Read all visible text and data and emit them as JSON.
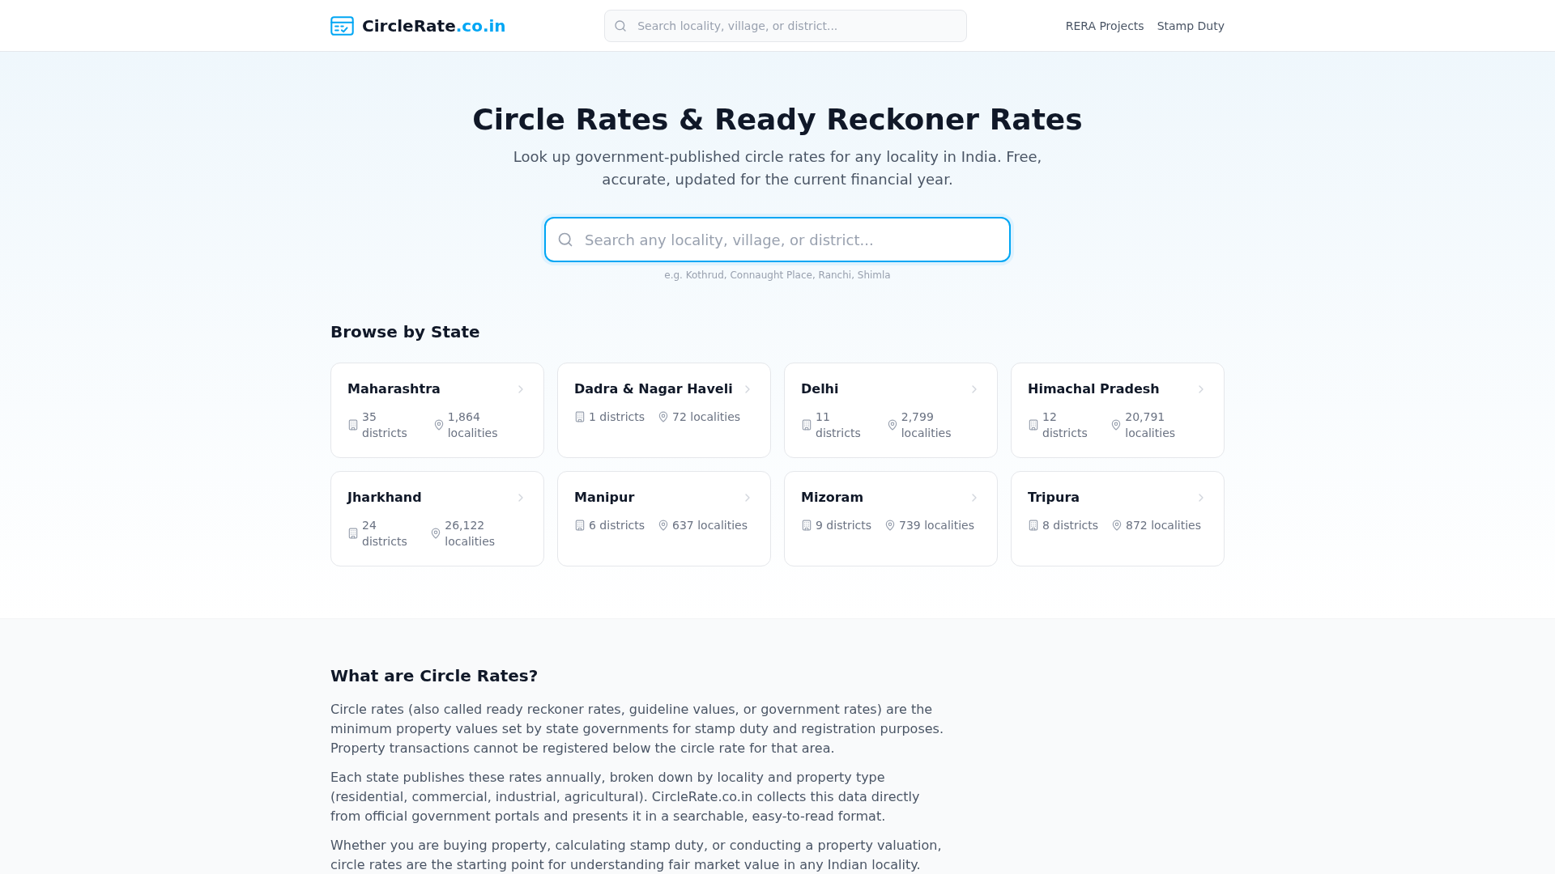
{
  "header": {
    "logo": {
      "name": "CircleRate",
      "suffix": ".co.in"
    },
    "search": {
      "placeholder": "Search locality, village, or district..."
    },
    "nav": [
      "RERA Projects",
      "Stamp Duty"
    ]
  },
  "hero": {
    "title": "Circle Rates & Ready Reckoner Rates",
    "subtitle": "Look up government-published circle rates for any locality in India. Free, accurate, updated for the current financial year.",
    "search": {
      "placeholder": "Search any locality, village, or district...",
      "focused": true
    },
    "hint": "e.g. Kothrud, Connaught Place, Ranchi, Shimla"
  },
  "browse": {
    "heading": "Browse by State",
    "states": [
      {
        "name": "Maharashtra",
        "districts": "35 districts",
        "localities": "1,864 localities"
      },
      {
        "name": "Dadra & Nagar Haveli",
        "districts": "1 districts",
        "localities": "72 localities"
      },
      {
        "name": "Delhi",
        "districts": "11 districts",
        "localities": "2,799 localities"
      },
      {
        "name": "Himachal Pradesh",
        "districts": "12 districts",
        "localities": "20,791 localities"
      },
      {
        "name": "Jharkhand",
        "districts": "24 districts",
        "localities": "26,122 localities"
      },
      {
        "name": "Manipur",
        "districts": "6 districts",
        "localities": "637 localities"
      },
      {
        "name": "Mizoram",
        "districts": "9 districts",
        "localities": "739 localities"
      },
      {
        "name": "Tripura",
        "districts": "8 districts",
        "localities": "872 localities"
      }
    ]
  },
  "about": {
    "heading": "What are Circle Rates?",
    "paragraphs": [
      "Circle rates (also called ready reckoner rates, guideline values, or government rates) are the minimum property values set by state governments for stamp duty and registration purposes. Property transactions cannot be registered below the circle rate for that area.",
      "Each state publishes these rates annually, broken down by locality and property type (residential, commercial, industrial, agricultural). CircleRate.co.in collects this data directly from official government portals and presents it in a searchable, easy-to-read format.",
      "Whether you are buying property, calculating stamp duty, or conducting a property valuation, circle rates are the starting point for understanding fair market value in any Indian locality."
    ]
  }
}
